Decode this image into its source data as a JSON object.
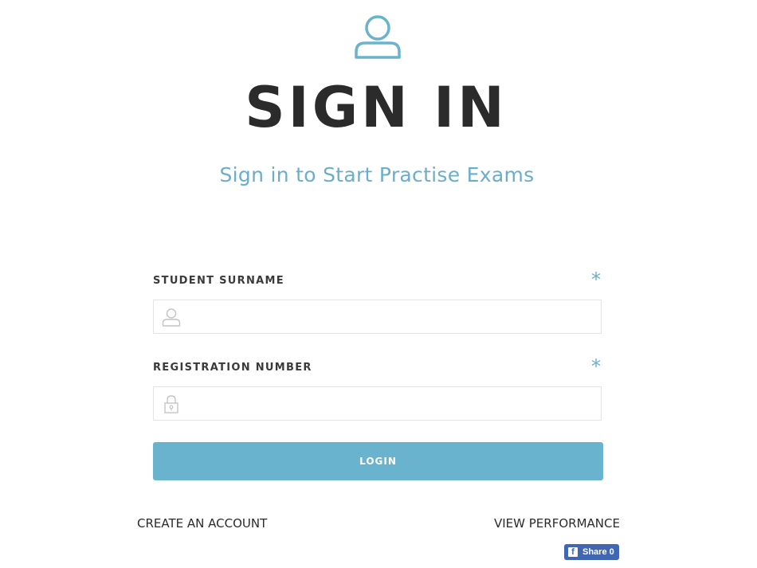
{
  "header": {
    "icon": "user-icon",
    "title": "SIGN IN",
    "subtitle": "Sign in to Start Practise Exams"
  },
  "form": {
    "surname": {
      "label": "STUDENT SURNAME",
      "required_mark": "*",
      "icon": "user-icon",
      "value": "",
      "placeholder": ""
    },
    "registration": {
      "label": "REGISTRATION NUMBER",
      "required_mark": "*",
      "icon": "lock-icon",
      "value": "",
      "placeholder": ""
    },
    "login_label": "LOGIN"
  },
  "links": {
    "create_account": "CREATE AN ACCOUNT",
    "view_performance": "VIEW PERFORMANCE"
  },
  "share": {
    "icon": "facebook-icon",
    "label": "Share 0"
  },
  "colors": {
    "accent": "#69b3cf",
    "title_text": "#2b2b2b",
    "facebook": "#4267b2"
  }
}
